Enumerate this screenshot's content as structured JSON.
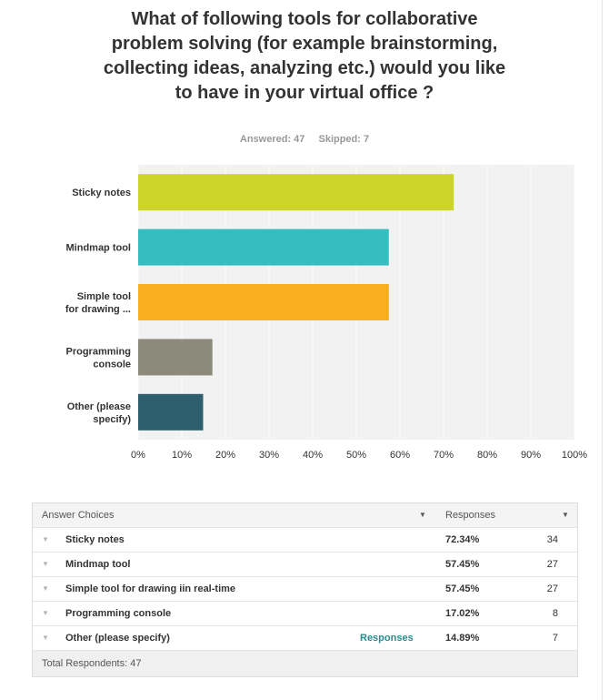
{
  "question": {
    "title": "What of following tools for collaborative problem solving (for example brainstorming, collecting ideas, analyzing etc.) would you like to have in your virtual office ?",
    "answered": "Answered: 47",
    "skipped": "Skipped: 7"
  },
  "chart_data": {
    "type": "bar",
    "orientation": "horizontal",
    "categories": [
      [
        "Sticky notes"
      ],
      [
        "Mindmap tool"
      ],
      [
        "Simple tool",
        "for drawing ..."
      ],
      [
        "Programming",
        "console"
      ],
      [
        "Other (please",
        "specify)"
      ]
    ],
    "values": [
      72.34,
      57.45,
      57.45,
      17.02,
      14.89
    ],
    "colors": [
      "#cdd628",
      "#35bdbf",
      "#f7ae1f",
      "#8c8b7b",
      "#2e5f6e"
    ],
    "xlim": [
      0,
      100
    ],
    "xticks": [
      "0%",
      "10%",
      "20%",
      "30%",
      "40%",
      "50%",
      "60%",
      "70%",
      "80%",
      "90%",
      "100%"
    ],
    "grid": true,
    "background": "#f2f2f2"
  },
  "table": {
    "header": {
      "choices": "Answer Choices",
      "responses": "Responses"
    },
    "rows": [
      {
        "label": "Sticky notes",
        "pct": "72.34%",
        "count": "34",
        "link": ""
      },
      {
        "label": "Mindmap tool",
        "pct": "57.45%",
        "count": "27",
        "link": ""
      },
      {
        "label": "Simple tool for drawing iin real-time",
        "pct": "57.45%",
        "count": "27",
        "link": ""
      },
      {
        "label": "Programming console",
        "pct": "17.02%",
        "count": "8",
        "link": ""
      },
      {
        "label": "Other (please specify)",
        "pct": "14.89%",
        "count": "7",
        "link": "Responses"
      }
    ],
    "footer": "Total Respondents: 47"
  },
  "icons": {
    "sort": "chevron-down-icon",
    "row": "triangle-down-icon"
  }
}
